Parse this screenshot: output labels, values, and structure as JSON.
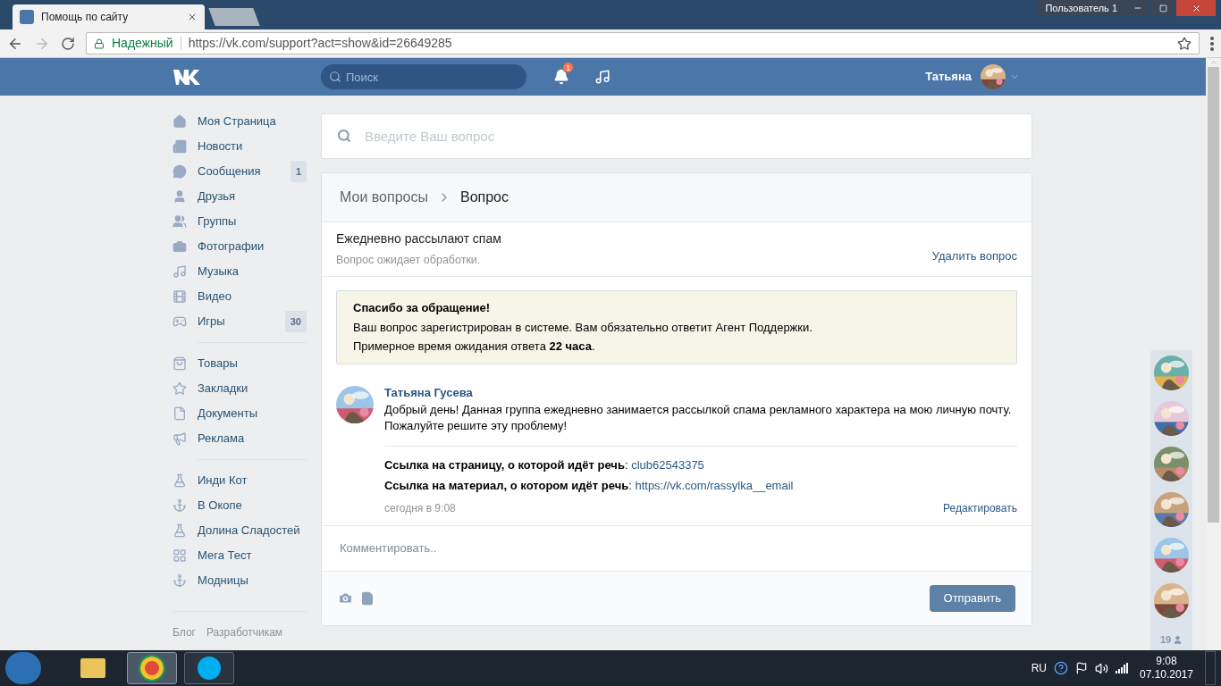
{
  "browser": {
    "tab_title": "Помощь по сайту",
    "security": "Надежный",
    "url": "https://vk.com/support?act=show&id=26649285",
    "profile": "Пользователь 1"
  },
  "header": {
    "search_placeholder": "Поиск",
    "notification_count": "1",
    "user_name": "Татьяна"
  },
  "sidebar": {
    "sections": [
      [
        {
          "label": "Моя Страница"
        },
        {
          "label": "Новости"
        },
        {
          "label": "Сообщения",
          "badge": "1"
        },
        {
          "label": "Друзья"
        },
        {
          "label": "Группы"
        },
        {
          "label": "Фотографии"
        },
        {
          "label": "Музыка"
        },
        {
          "label": "Видео"
        },
        {
          "label": "Игры",
          "badge": "30"
        }
      ],
      [
        {
          "label": "Товары"
        },
        {
          "label": "Закладки"
        },
        {
          "label": "Документы"
        },
        {
          "label": "Реклама"
        }
      ],
      [
        {
          "label": "Инди Кот"
        },
        {
          "label": "В Окопе"
        },
        {
          "label": "Долина Сладостей"
        },
        {
          "label": "Мега Тест"
        },
        {
          "label": "Модницы"
        }
      ]
    ],
    "footer_links": [
      "Блог",
      "Разработчикам"
    ]
  },
  "question_search": {
    "placeholder": "Введите Ваш вопрос"
  },
  "breadcrumbs": [
    "Мои вопросы",
    "Вопрос"
  ],
  "question": {
    "title": "Ежедневно рассылают спам",
    "status": "Вопрос ожидает обработки.",
    "delete": "Удалить вопрос"
  },
  "notice": {
    "title": "Спасибо за обращение!",
    "lines": [
      "Ваш вопрос зарегистрирован в системе. Вам обязательно ответит Агент Поддержки.",
      "Примерное время ожидания ответа **22 часа**."
    ]
  },
  "message": {
    "author": "Татьяна Гусева",
    "text": "Добрый день! Данная группа ежедневно занимается рассылкой спама рекламного характера на мою личную почту. Пожалуйте решите эту проблему!",
    "fields": [
      {
        "label": "Ссылка на страницу, о которой идёт речь",
        "separator": ":",
        "value": "club62543375"
      },
      {
        "label": "Ссылка на материал, о котором идёт речь",
        "separator": ":",
        "value": "https://vk.com/rassylka__email"
      }
    ],
    "time": "сегодня в 9:08",
    "edit": "Редактировать"
  },
  "comment": {
    "placeholder": "Комментировать..",
    "send": "Отправить"
  },
  "friends_panel": {
    "count": "19"
  },
  "taskbar": {
    "language": "RU",
    "time": "9:08",
    "date": "07.10.2017"
  }
}
